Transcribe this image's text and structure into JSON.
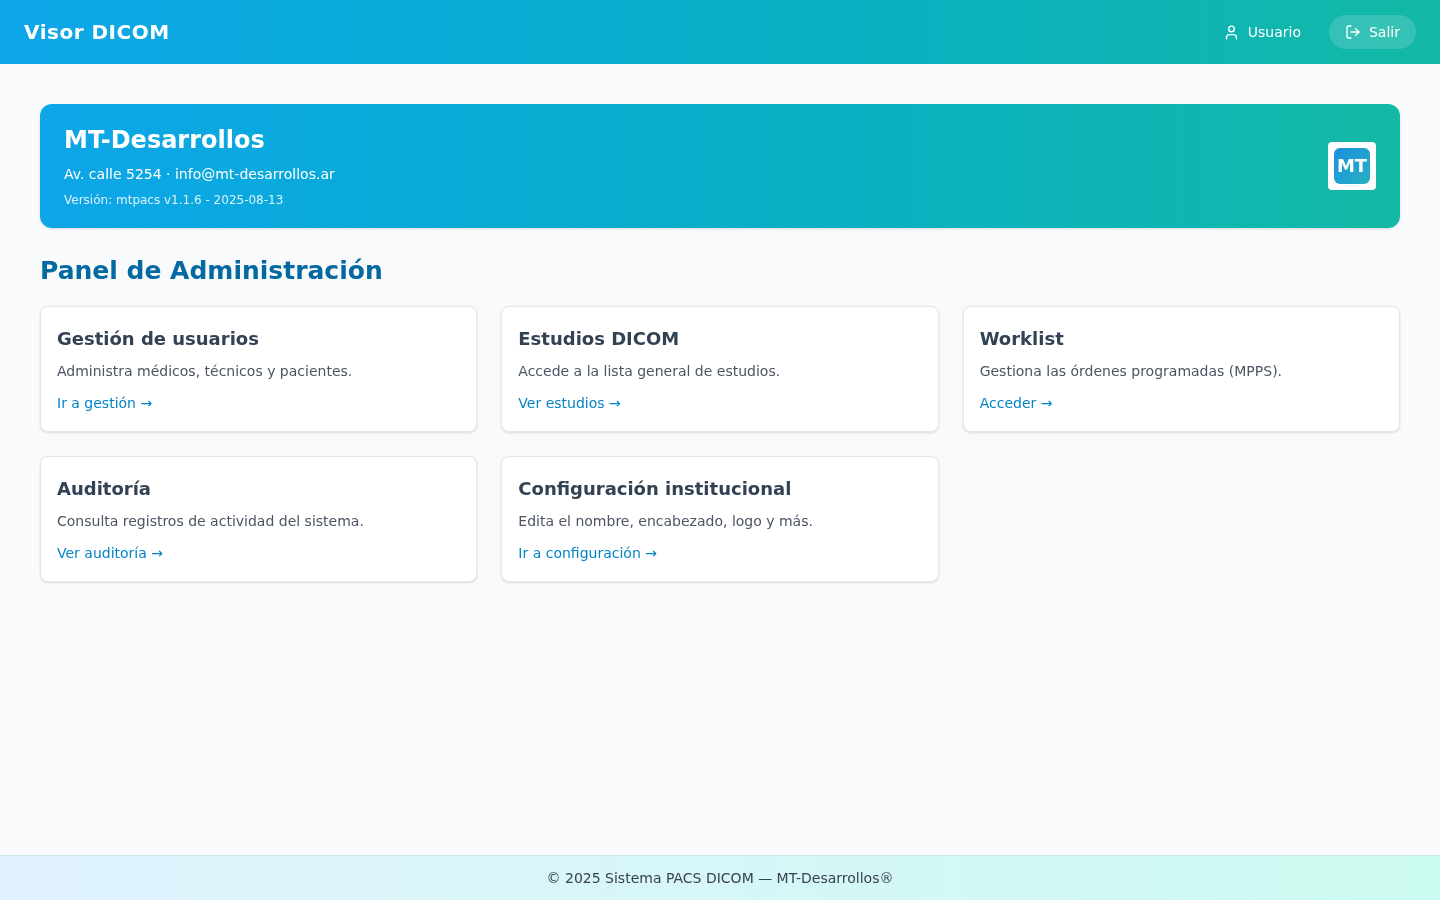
{
  "header": {
    "title": "Visor DICOM",
    "user": "Usuario",
    "logout": "Salir"
  },
  "banner": {
    "name": "MT-Desarrollos",
    "address": "Av. calle 5254 · info@mt-desarrollos.ar",
    "version": "Versión: mtpacs v1.1.6 - 2025-08-13",
    "logo": "MT"
  },
  "panel_title": "Panel de Administración",
  "cards": [
    {
      "title": "Gestión de usuarios",
      "description": "Administra médicos, técnicos y pacientes.",
      "link": "Ir a gestión →"
    },
    {
      "title": "Estudios DICOM",
      "description": "Accede a la lista general de estudios.",
      "link": "Ver estudios →"
    },
    {
      "title": "Worklist",
      "description": "Gestiona las órdenes programadas (MPPS).",
      "link": "Acceder →"
    },
    {
      "title": "Auditoría",
      "description": "Consulta registros de actividad del sistema.",
      "link": "Ver auditoría →"
    },
    {
      "title": "Configuración institucional",
      "description": "Edita el nombre, encabezado, logo y más.",
      "link": "Ir a configuración →"
    }
  ],
  "footer": "© 2025 Sistema PACS DICOM — MT-Desarrollos®"
}
